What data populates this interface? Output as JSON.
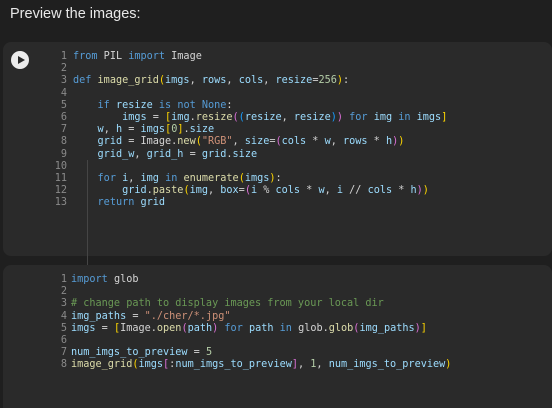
{
  "heading": "Preview the images:",
  "cells": [
    {
      "lines": [
        "from PIL import Image",
        "",
        "def image_grid(imgs, rows, cols, resize=256):",
        "",
        "    if resize is not None:",
        "        imgs = [img.resize((resize, resize)) for img in imgs]",
        "    w, h = imgs[0].size",
        "    grid = Image.new(\"RGB\", size=(cols * w, rows * h))",
        "    grid_w, grid_h = grid.size",
        "",
        "    for i, img in enumerate(imgs):",
        "        grid.paste(img, box=(i % cols * w, i // cols * h))",
        "    return grid"
      ]
    },
    {
      "lines": [
        "import glob",
        "",
        "# change path to display images from your local dir",
        "img_paths = \"./cher/*.jpg\"",
        "imgs = [Image.open(path) for path in glob.glob(img_paths)]",
        "",
        "num_imgs_to_preview = 5",
        "image_grid(imgs[:num_imgs_to_preview], 1, num_imgs_to_preview)"
      ]
    }
  ]
}
